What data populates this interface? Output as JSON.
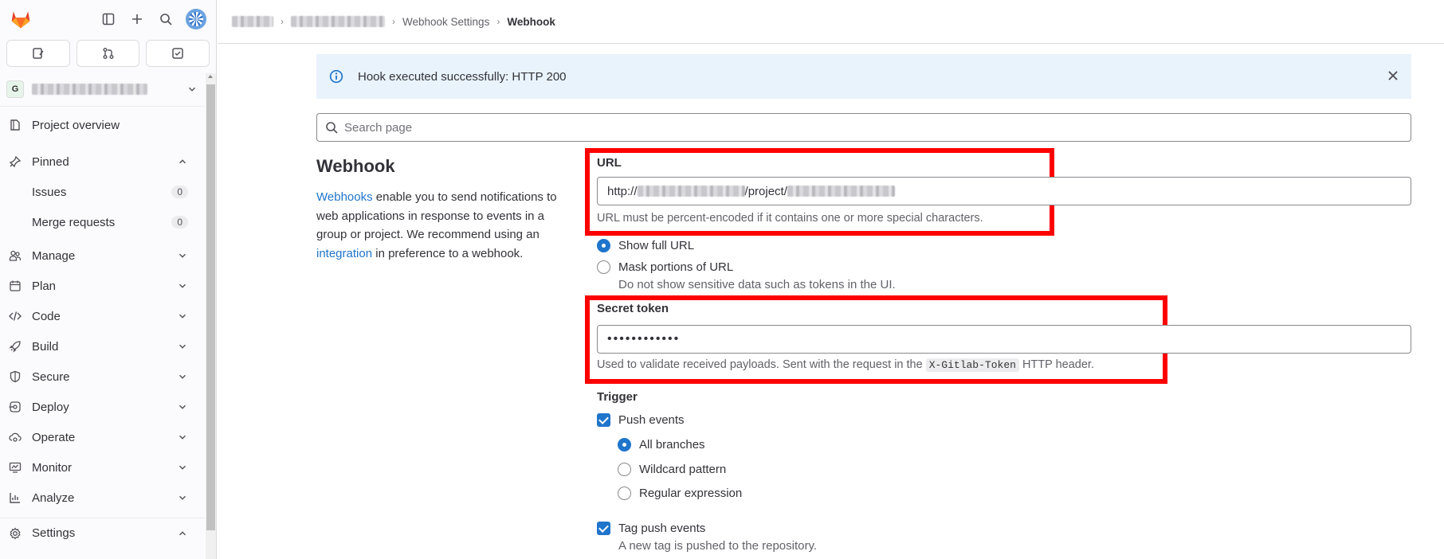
{
  "sidebar": {
    "tabs": [
      "issues-tab",
      "merge-requests-tab",
      "todos-tab"
    ],
    "project_initial": "G",
    "nav": {
      "project_overview": "Project overview",
      "pinned": "Pinned",
      "issues": "Issues",
      "issues_count": "0",
      "merge_requests": "Merge requests",
      "merge_requests_count": "0",
      "manage": "Manage",
      "plan": "Plan",
      "code": "Code",
      "build": "Build",
      "secure": "Secure",
      "deploy": "Deploy",
      "operate": "Operate",
      "monitor": "Monitor",
      "analyze": "Analyze",
      "settings": "Settings"
    }
  },
  "breadcrumb": {
    "webhook_settings": "Webhook Settings",
    "current": "Webhook"
  },
  "alert": {
    "message": "Hook executed successfully: HTTP 200"
  },
  "search": {
    "placeholder": "Search page"
  },
  "intro": {
    "title": "Webhook",
    "link_webhooks": "Webhooks",
    "text1": " enable you to send notifications to web applications in response to events in a group or project. We recommend using an ",
    "link_integration": "integration",
    "text2": " in preference to a webhook."
  },
  "url_field": {
    "label": "URL",
    "value_prefix": "http://",
    "value_mid": "/project/",
    "help": "URL must be percent-encoded if it contains one or more special characters."
  },
  "url_display": {
    "show_full": "Show full URL",
    "mask": "Mask portions of URL",
    "mask_help": "Do not show sensitive data such as tokens in the UI."
  },
  "secret_token": {
    "label": "Secret token",
    "value": "••••••••••••",
    "help_prefix": "Used to validate received payloads. Sent with the request in the ",
    "help_code": "X-Gitlab-Token",
    "help_suffix": " HTTP header."
  },
  "trigger": {
    "label": "Trigger",
    "push_events": "Push events",
    "all_branches": "All branches",
    "wildcard": "Wildcard pattern",
    "regex": "Regular expression",
    "tag_push": "Tag push events",
    "tag_push_help": "A new tag is pushed to the repository."
  },
  "colors": {
    "accent": "#1f75cb",
    "highlight": "#ff0000",
    "alert_bg": "#e9f3fc"
  }
}
